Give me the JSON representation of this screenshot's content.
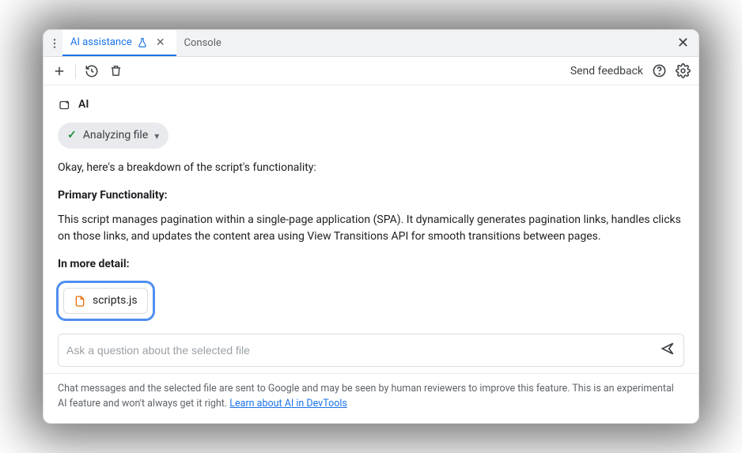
{
  "tabs": {
    "ai_label": "AI assistance",
    "console_label": "Console"
  },
  "toolbar": {
    "feedback_label": "Send feedback"
  },
  "ai": {
    "title": "AI",
    "chip_label": "Analyzing file",
    "intro": "Okay, here's a breakdown of the script's functionality:",
    "heading1": "Primary Functionality:",
    "body1": "This script manages pagination within a single-page application (SPA). It dynamically generates pagination links, handles clicks on those links, and updates the content area using View Transitions API for smooth transitions between pages.",
    "heading2": "In more detail:",
    "file_name": "scripts.js"
  },
  "input": {
    "placeholder": "Ask a question about the selected file"
  },
  "footer": {
    "text": "Chat messages and the selected file are sent to Google and may be seen by human reviewers to improve this feature. This is an experimental AI feature and won't always get it right. ",
    "link_text": "Learn about AI in DevTools"
  }
}
